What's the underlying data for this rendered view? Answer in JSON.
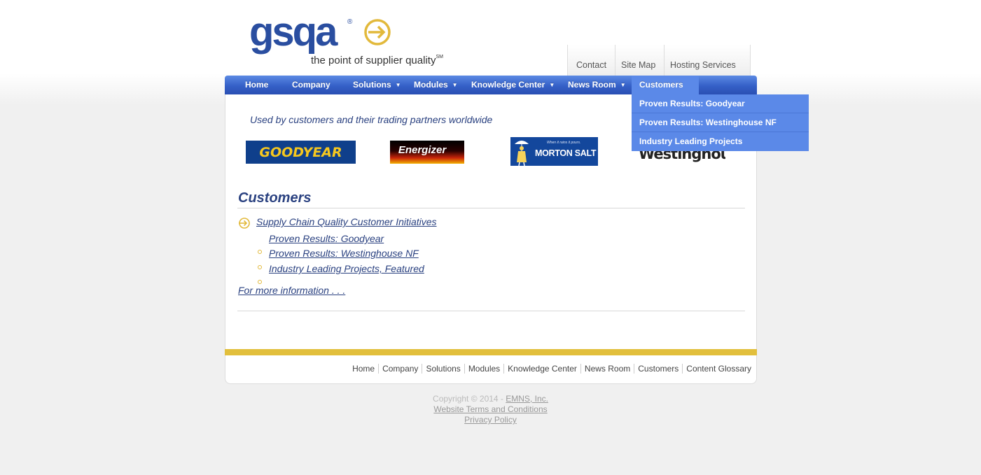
{
  "header": {
    "logo_word": "gsqa",
    "logo_registered": "®",
    "logo_tagline": "the point of supplier quality",
    "logo_tagline_mark": "SM",
    "utility_links": [
      "Contact",
      "Site Map",
      "Hosting Services"
    ]
  },
  "main_nav": {
    "items": [
      {
        "label": "Home",
        "has_dropdown": false
      },
      {
        "label": "Company",
        "has_dropdown": false
      },
      {
        "label": "Solutions",
        "has_dropdown": true
      },
      {
        "label": "Modules",
        "has_dropdown": true
      },
      {
        "label": "Knowledge Center",
        "has_dropdown": true
      },
      {
        "label": "News Room",
        "has_dropdown": true
      },
      {
        "label": "Customers",
        "has_dropdown": false,
        "active": true
      }
    ],
    "caret": "▼",
    "dropdown": [
      "Proven Results: Goodyear",
      "Proven Results: Westinghouse NF",
      "Industry Leading Projects"
    ]
  },
  "content": {
    "intro": "Used by customers and their trading partners worldwide",
    "customer_logos": {
      "goodyear": "GOODYEAR",
      "energizer": "Energizer",
      "morton": "MORTON SALT",
      "morton_slogan": "When it rains it pours.",
      "westinghouse": "Westinghouse"
    },
    "title": "Customers",
    "main_link": "Supply Chain Quality Customer Initiatives",
    "sub_links": [
      "Proven Results: Goodyear",
      "Proven Results: Westinghouse NF",
      "Industry Leading Projects, Featured"
    ],
    "more_info": "For more information . . ."
  },
  "footer": {
    "links": [
      "Home",
      "Company",
      "Solutions",
      "Modules",
      "Knowledge Center",
      "News Room",
      "Customers",
      "Content Glossary"
    ],
    "copyright_prefix": "Copyright © 2014 - ",
    "copyright_company": "EMNS, Inc.",
    "terms": "Website Terms and Conditions",
    "privacy": "Privacy Policy"
  },
  "colors": {
    "brand_blue": "#2a4ea0",
    "nav_blue": "#3560c7",
    "dropdown_blue": "#5b89e8",
    "accent_gold": "#e2bf3c",
    "link_blue": "#2a4180"
  }
}
